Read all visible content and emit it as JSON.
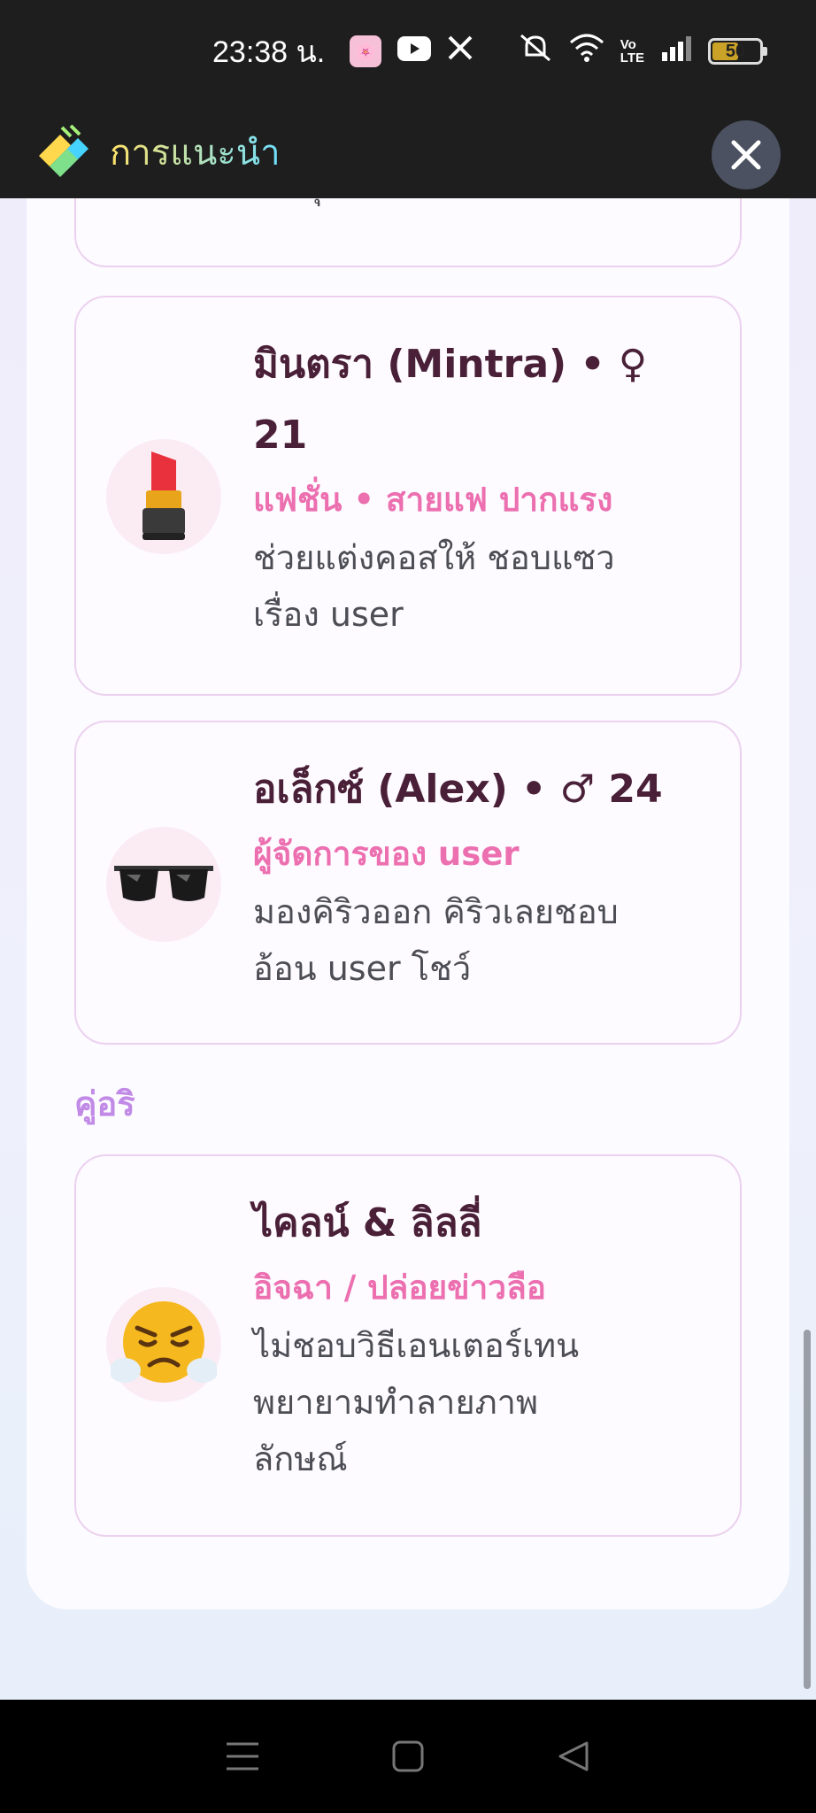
{
  "status_bar": {
    "time": "23:38 น.",
    "battery": "50",
    "icons": [
      "app-avatar-icon",
      "youtube-icon",
      "x-icon",
      "mute-icon",
      "wifi-icon",
      "volte-icon",
      "signal-icon",
      "battery-icon"
    ]
  },
  "header": {
    "title": "การแนะนำ",
    "close_icon": "close-icon"
  },
  "top_card": {
    "desc_tail": "ที่สุด"
  },
  "cards": [
    {
      "emoji": "💄",
      "name": "มินตรา (Mintra) • ♀",
      "name_line2": "21",
      "role": "แฟชั่น • สายแฟ ปากแรง",
      "desc_line1": "ช่วยแต่งคอสให้ ชอบแซว",
      "desc_line2": "เรื่อง user"
    },
    {
      "emoji": "🕶️",
      "name": "อเล็กซ์ (Alex) • ♂ 24",
      "role": "ผู้จัดการของ user",
      "desc_line1": "มองคิริวออก คิริวเลยชอบ",
      "desc_line2": "อ้อน user โชว์"
    }
  ],
  "section": {
    "label": "คู่อริ"
  },
  "rival_card": {
    "emoji": "😤",
    "name": "ไคลน์ & ลิลลี่",
    "role": "อิจฉา / ปล่อยข่าวลือ",
    "desc_line1": "ไม่ชอบวิธีเอนเตอร์เทน",
    "desc_line2": "พยายามทำลายภาพ",
    "desc_line3": "ลักษณ์"
  },
  "colors": {
    "name": "#4a2038",
    "role": "#ec6fb0",
    "section": "#c18ae6",
    "card_border": "#ecd2f0"
  }
}
